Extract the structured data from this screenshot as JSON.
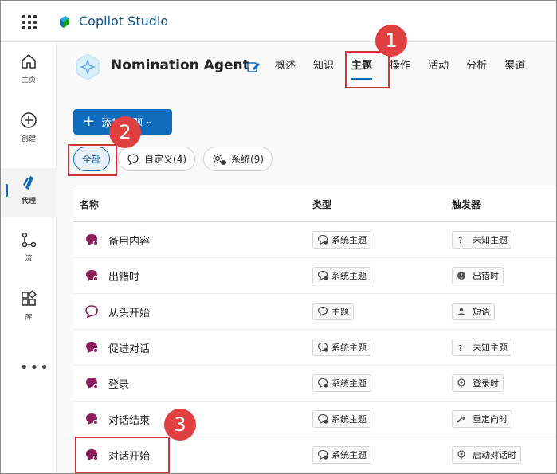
{
  "app": {
    "title": "Copilot Studio"
  },
  "rail": {
    "items": [
      {
        "label": "主页",
        "icon": "home-icon"
      },
      {
        "label": "创建",
        "icon": "add-circle-icon"
      },
      {
        "label": "代理",
        "icon": "agent-icon"
      },
      {
        "label": "流",
        "icon": "flow-icon"
      },
      {
        "label": "库",
        "icon": "library-icon"
      }
    ],
    "more": "•••"
  },
  "agent": {
    "name": "Nomination Agent",
    "tabs": [
      "概述",
      "知识",
      "主题",
      "操作",
      "活动",
      "分析",
      "渠道"
    ],
    "active_tab": "主题"
  },
  "toolbar": {
    "add_label": "添加主题"
  },
  "filters": {
    "all": "全部",
    "custom": "自定义(4)",
    "system": "系统(9)"
  },
  "table": {
    "headers": {
      "name": "名称",
      "type": "类型",
      "trigger": "触发器"
    },
    "rows": [
      {
        "name": "备用内容",
        "type": "系统主题",
        "trigger": "未知主题",
        "trigger_icon": "question-icon",
        "kind": "system"
      },
      {
        "name": "出错时",
        "type": "系统主题",
        "trigger": "出错时",
        "trigger_icon": "error-icon",
        "kind": "system"
      },
      {
        "name": "从头开始",
        "type": "主题",
        "trigger": "短语",
        "trigger_icon": "person-phrase-icon",
        "kind": "custom"
      },
      {
        "name": "促进对话",
        "type": "系统主题",
        "trigger": "未知主题",
        "trigger_icon": "question-icon",
        "kind": "system"
      },
      {
        "name": "登录",
        "type": "系统主题",
        "trigger": "登录时",
        "trigger_icon": "signin-icon",
        "kind": "system"
      },
      {
        "name": "对话结束",
        "type": "系统主题",
        "trigger": "重定向时",
        "trigger_icon": "redirect-icon",
        "kind": "system"
      },
      {
        "name": "对话开始",
        "type": "系统主题",
        "trigger": "启动对话时",
        "trigger_icon": "start-icon",
        "kind": "system"
      }
    ]
  },
  "annotations": [
    "1",
    "2",
    "3"
  ],
  "colors": {
    "accent": "#0f6cbd",
    "annotation": "#d13438",
    "topic_icon": "#8a1f5c"
  }
}
